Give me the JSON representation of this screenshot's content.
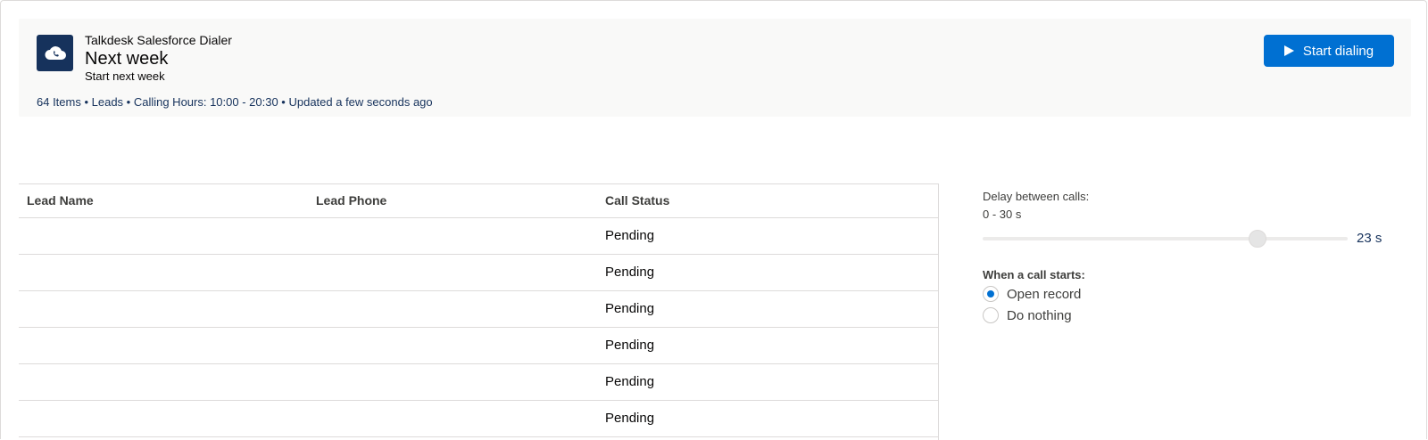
{
  "header": {
    "app_name": "Talkdesk Salesforce Dialer",
    "list_title": "Next week",
    "list_subtitle": "Start next week",
    "meta": "64 Items • Leads • Calling Hours: 10:00 - 20:30 • Updated a few seconds ago",
    "start_button": "Start dialing",
    "icon": "cloud-phone-icon",
    "accent": "#0070d2",
    "icon_bg": "#16325c"
  },
  "table": {
    "columns": [
      "Lead Name",
      "Lead Phone",
      "Call Status"
    ],
    "rows": [
      {
        "name": "",
        "phone": "",
        "status": "Pending"
      },
      {
        "name": "",
        "phone": "",
        "status": "Pending"
      },
      {
        "name": "",
        "phone": "",
        "status": "Pending"
      },
      {
        "name": "",
        "phone": "",
        "status": "Pending"
      },
      {
        "name": "",
        "phone": "",
        "status": "Pending"
      },
      {
        "name": "",
        "phone": "",
        "status": "Pending"
      }
    ]
  },
  "settings": {
    "delay_label": "Delay between calls:",
    "delay_range": "0 - 30 s",
    "delay_min": 0,
    "delay_max": 30,
    "delay_value": 23,
    "delay_value_text": "23 s",
    "call_start_label": "When a call starts:",
    "options": [
      {
        "label": "Open record",
        "checked": true
      },
      {
        "label": "Do nothing",
        "checked": false
      }
    ]
  }
}
